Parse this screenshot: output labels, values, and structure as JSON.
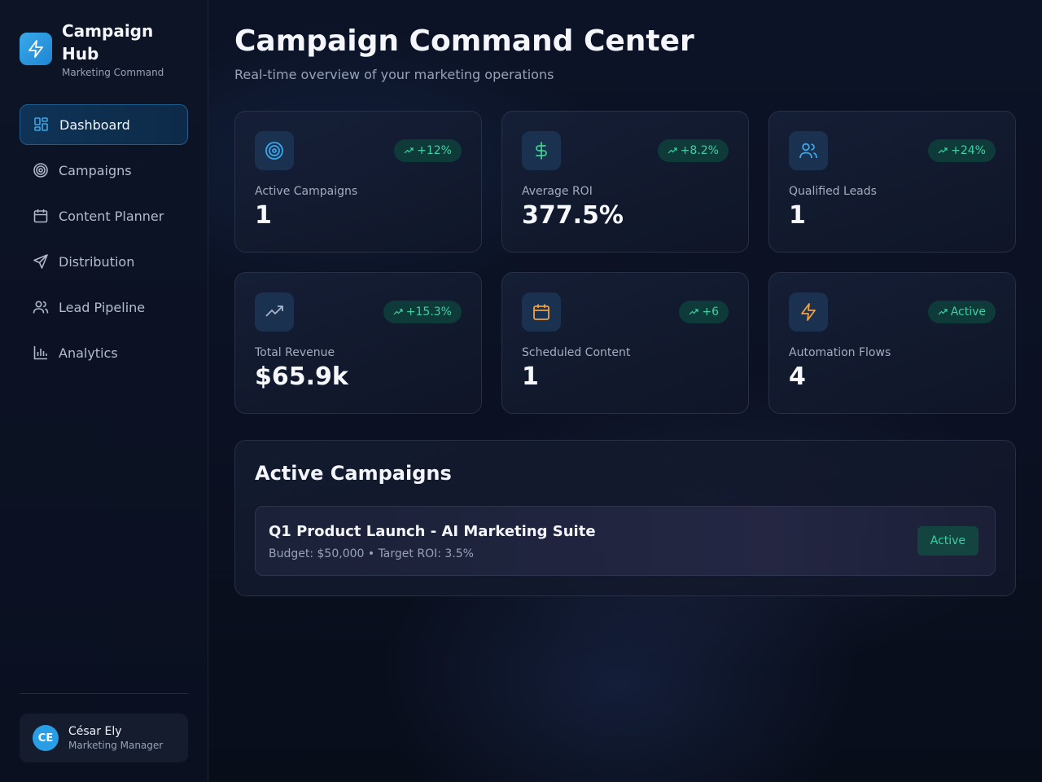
{
  "brand": {
    "title": "Campaign Hub",
    "subtitle": "Marketing Command"
  },
  "nav": [
    {
      "label": "Dashboard",
      "icon": "dashboard-icon",
      "active": true
    },
    {
      "label": "Campaigns",
      "icon": "target-icon",
      "active": false
    },
    {
      "label": "Content Planner",
      "icon": "calendar-icon",
      "active": false
    },
    {
      "label": "Distribution",
      "icon": "send-icon",
      "active": false
    },
    {
      "label": "Lead Pipeline",
      "icon": "users-icon",
      "active": false
    },
    {
      "label": "Analytics",
      "icon": "bar-chart-icon",
      "active": false
    }
  ],
  "user": {
    "initials": "CE",
    "name": "César Ely",
    "role": "Marketing Manager"
  },
  "header": {
    "title": "Campaign Command Center",
    "subtitle": "Real-time overview of your marketing operations"
  },
  "stats": [
    {
      "label": "Active Campaigns",
      "value": "1",
      "badge": "+12%",
      "icon": "target-icon",
      "icon_color": "#38a8ec"
    },
    {
      "label": "Average ROI",
      "value": "377.5%",
      "badge": "+8.2%",
      "icon": "dollar-icon",
      "icon_color": "#3ecf8e"
    },
    {
      "label": "Qualified Leads",
      "value": "1",
      "badge": "+24%",
      "icon": "users-icon",
      "icon_color": "#38a8ec"
    },
    {
      "label": "Total Revenue",
      "value": "$65.9k",
      "badge": "+15.3%",
      "icon": "trending-up-icon",
      "icon_color": "#a8b4c8"
    },
    {
      "label": "Scheduled Content",
      "value": "1",
      "badge": "+6",
      "icon": "calendar-icon",
      "icon_color": "#f0a040"
    },
    {
      "label": "Automation Flows",
      "value": "4",
      "badge": "Active",
      "icon": "zap-icon",
      "icon_color": "#f0a040"
    }
  ],
  "active_campaigns": {
    "title": "Active Campaigns",
    "items": [
      {
        "name": "Q1 Product Launch - AI Marketing Suite",
        "meta": "Budget: $50,000 • Target ROI: 3.5%",
        "status": "Active"
      }
    ]
  },
  "colors": {
    "accent": "#2a9ee4",
    "success": "#3fd0a2",
    "background": "#0b1122"
  }
}
